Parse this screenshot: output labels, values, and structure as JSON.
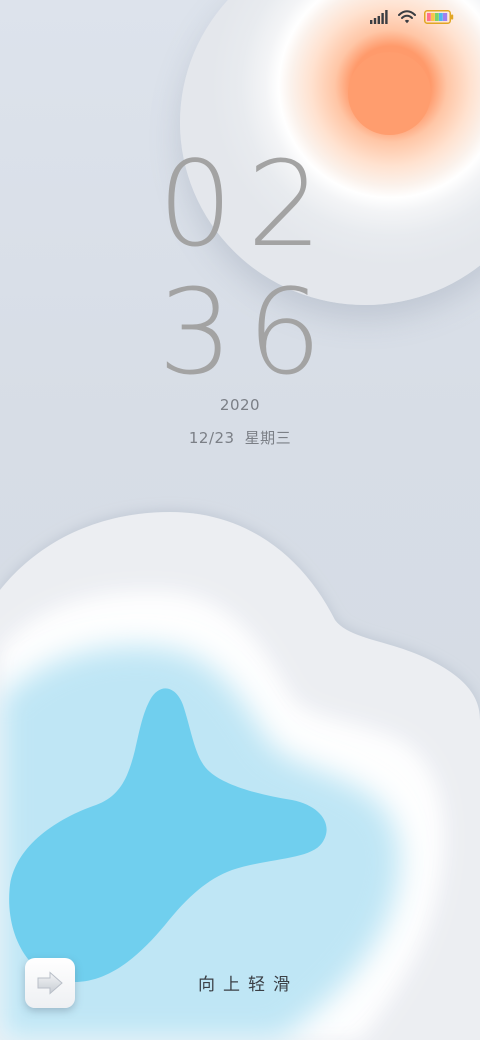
{
  "status_bar": {
    "signal_icon": "signal-bars-icon",
    "wifi_icon": "wifi-icon",
    "battery_icon": "battery-icon"
  },
  "clock": {
    "hours": "02",
    "minutes": "36"
  },
  "date": {
    "year": "2020",
    "month_day": "12/23",
    "weekday": "星期三"
  },
  "colors": {
    "sun": "#ff9d6e",
    "cloud_core": "#70cfee",
    "clock_text": "#a3a3a3"
  },
  "bottom": {
    "launcher_icon": "arrow-right-icon",
    "swipe_hint": "向上轻滑"
  }
}
